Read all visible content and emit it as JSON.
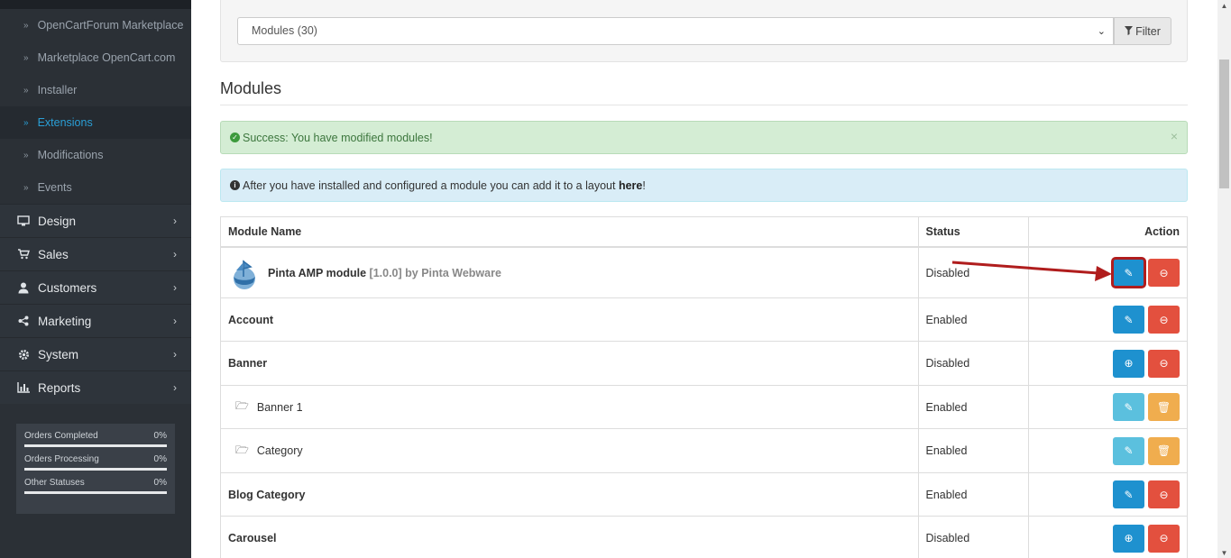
{
  "sidebar": {
    "sub_items": [
      {
        "label": "OpenCartForum Marketplace",
        "active": false
      },
      {
        "label": "Marketplace OpenCart.com",
        "active": false
      },
      {
        "label": "Installer",
        "active": false
      },
      {
        "label": "Extensions",
        "active": true
      },
      {
        "label": "Modifications",
        "active": false
      },
      {
        "label": "Events",
        "active": false
      }
    ],
    "main_items": [
      {
        "label": "Design",
        "icon": "desktop-icon"
      },
      {
        "label": "Sales",
        "icon": "cart-icon"
      },
      {
        "label": "Customers",
        "icon": "user-icon"
      },
      {
        "label": "Marketing",
        "icon": "share-icon"
      },
      {
        "label": "System",
        "icon": "gear-icon"
      },
      {
        "label": "Reports",
        "icon": "bar-chart-icon"
      }
    ],
    "stats": [
      {
        "label": "Orders Completed",
        "value": "0%"
      },
      {
        "label": "Orders Processing",
        "value": "0%"
      },
      {
        "label": "Other Statuses",
        "value": "0%"
      }
    ]
  },
  "filter": {
    "select_value": "Modules (30)",
    "button_label": "Filter"
  },
  "page": {
    "heading": "Modules"
  },
  "alerts": {
    "success": "Success: You have modified modules!",
    "info_prefix": "After you have installed and configured a module you can add it to a layout ",
    "info_link": "here",
    "info_suffix": "!"
  },
  "table": {
    "headers": {
      "name": "Module Name",
      "status": "Status",
      "action": "Action"
    },
    "rows": [
      {
        "name": "Pinta AMP module",
        "version": "[1.0.0]",
        "author": "by Pinta Webware",
        "status": "Disabled",
        "type": "parent",
        "actions": [
          "edit",
          "uninstall"
        ],
        "highlight": true
      },
      {
        "name": "Account",
        "status": "Enabled",
        "type": "parent",
        "actions": [
          "edit",
          "uninstall"
        ]
      },
      {
        "name": "Banner",
        "status": "Disabled",
        "type": "parent",
        "actions": [
          "add",
          "uninstall"
        ]
      },
      {
        "name": "Banner 1",
        "status": "Enabled",
        "type": "child",
        "actions": [
          "edit-light",
          "delete"
        ]
      },
      {
        "name": "Category",
        "status": "Enabled",
        "type": "child",
        "actions": [
          "edit-light",
          "delete"
        ]
      },
      {
        "name": "Blog Category",
        "status": "Enabled",
        "type": "parent",
        "actions": [
          "edit",
          "uninstall"
        ]
      },
      {
        "name": "Carousel",
        "status": "Disabled",
        "type": "parent",
        "actions": [
          "add",
          "uninstall"
        ]
      }
    ]
  },
  "colors": {
    "primary": "#1e91cf",
    "danger": "#e3503e",
    "info": "#5bc0de",
    "warning": "#f0ad4e",
    "sidebar": "#2b3036",
    "annotation": "#b01d1d"
  }
}
